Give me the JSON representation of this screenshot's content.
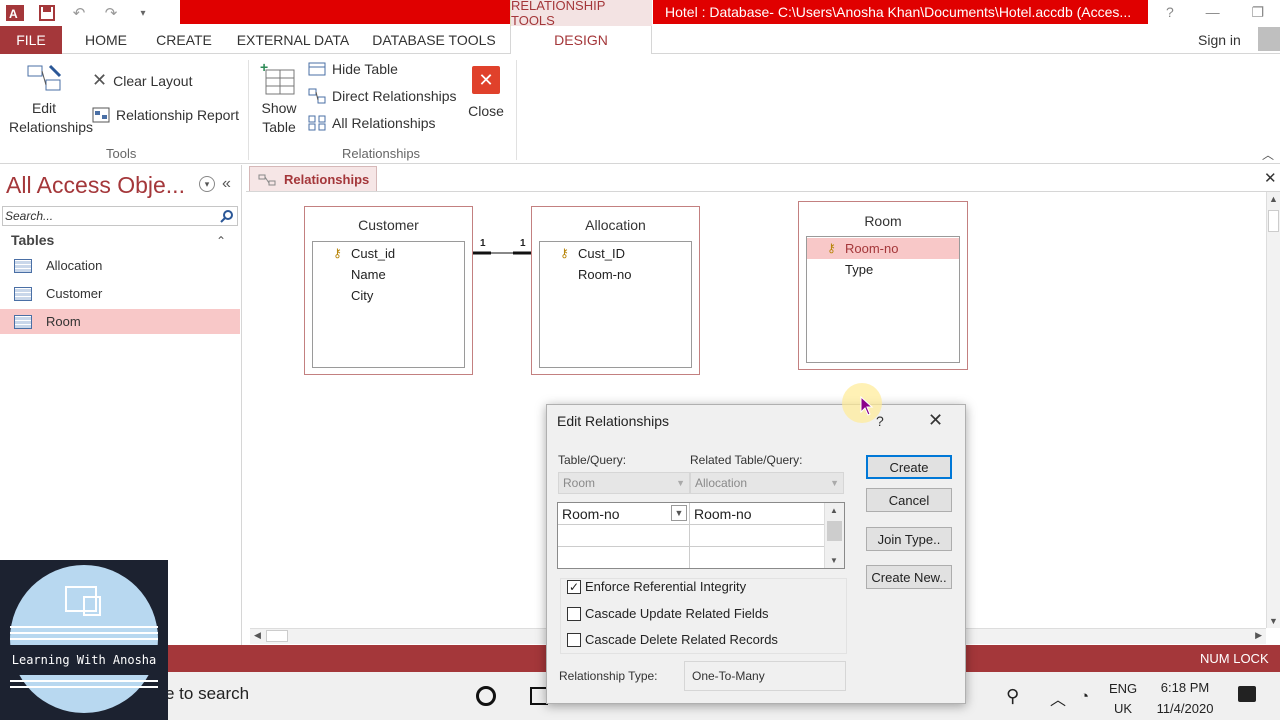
{
  "window": {
    "context_tools_label": "RELATIONSHIP TOOLS",
    "title": "Hotel : Database- C:\\Users\\Anosha Khan\\Documents\\Hotel.accdb (Acces...",
    "help": "?",
    "minimize": "—",
    "restore": "❐"
  },
  "ribbon_tabs": {
    "file": "FILE",
    "home": "HOME",
    "create": "CREATE",
    "external_data": "EXTERNAL DATA",
    "database_tools": "DATABASE TOOLS",
    "design": "DESIGN",
    "sign_in": "Sign in"
  },
  "ribbon": {
    "tools_group": {
      "label": "Tools",
      "edit_relationships": "Edit Relationships",
      "clear_layout": "Clear Layout",
      "relationship_report": "Relationship Report"
    },
    "relationships_group": {
      "label": "Relationships",
      "show_table": "Show Table",
      "hide_table": "Hide Table",
      "direct_relationships": "Direct Relationships",
      "all_relationships": "All Relationships",
      "close": "Close"
    }
  },
  "nav_pane": {
    "title": "All Access Obje...",
    "search_placeholder": "Search...",
    "section": "Tables",
    "items": [
      {
        "label": "Allocation"
      },
      {
        "label": "Customer"
      },
      {
        "label": "Room"
      }
    ]
  },
  "document_tab": "Relationships",
  "tables": {
    "customer": {
      "title": "Customer",
      "fields": [
        "Cust_id",
        "Name",
        "City"
      ]
    },
    "allocation": {
      "title": "Allocation",
      "fields": [
        "Cust_ID",
        "Room-no"
      ]
    },
    "room": {
      "title": "Room",
      "fields": [
        "Room-no",
        "Type"
      ]
    }
  },
  "relationship_labels": {
    "left": "1",
    "right": "1"
  },
  "dialog": {
    "title": "Edit Relationships",
    "help": "?",
    "close": "✕",
    "table_query_label": "Table/Query:",
    "related_table_query_label": "Related Table/Query:",
    "table_query_value": "Room",
    "related_table_query_value": "Allocation",
    "field_left": "Room-no",
    "field_right": "Room-no",
    "enforce_integrity": "Enforce Referential Integrity",
    "cascade_update": "Cascade Update Related Fields",
    "cascade_delete": "Cascade Delete Related Records",
    "relationship_type_label": "Relationship Type:",
    "relationship_type_value": "One-To-Many",
    "buttons": {
      "create": "Create",
      "cancel": "Cancel",
      "join_type": "Join Type..",
      "create_new": "Create New.."
    }
  },
  "status_bar": {
    "num_lock": "NUM LOCK"
  },
  "taskbar": {
    "search_text": "e to search",
    "lang_top": "ENG",
    "lang_bottom": "UK",
    "time": "6:18 PM",
    "date": "11/4/2020"
  },
  "watermark": {
    "text": "Learning With Anosha"
  },
  "colors": {
    "accent": "#a4373a",
    "title_red": "#e00000",
    "selected_row": "#f8c8c8"
  }
}
